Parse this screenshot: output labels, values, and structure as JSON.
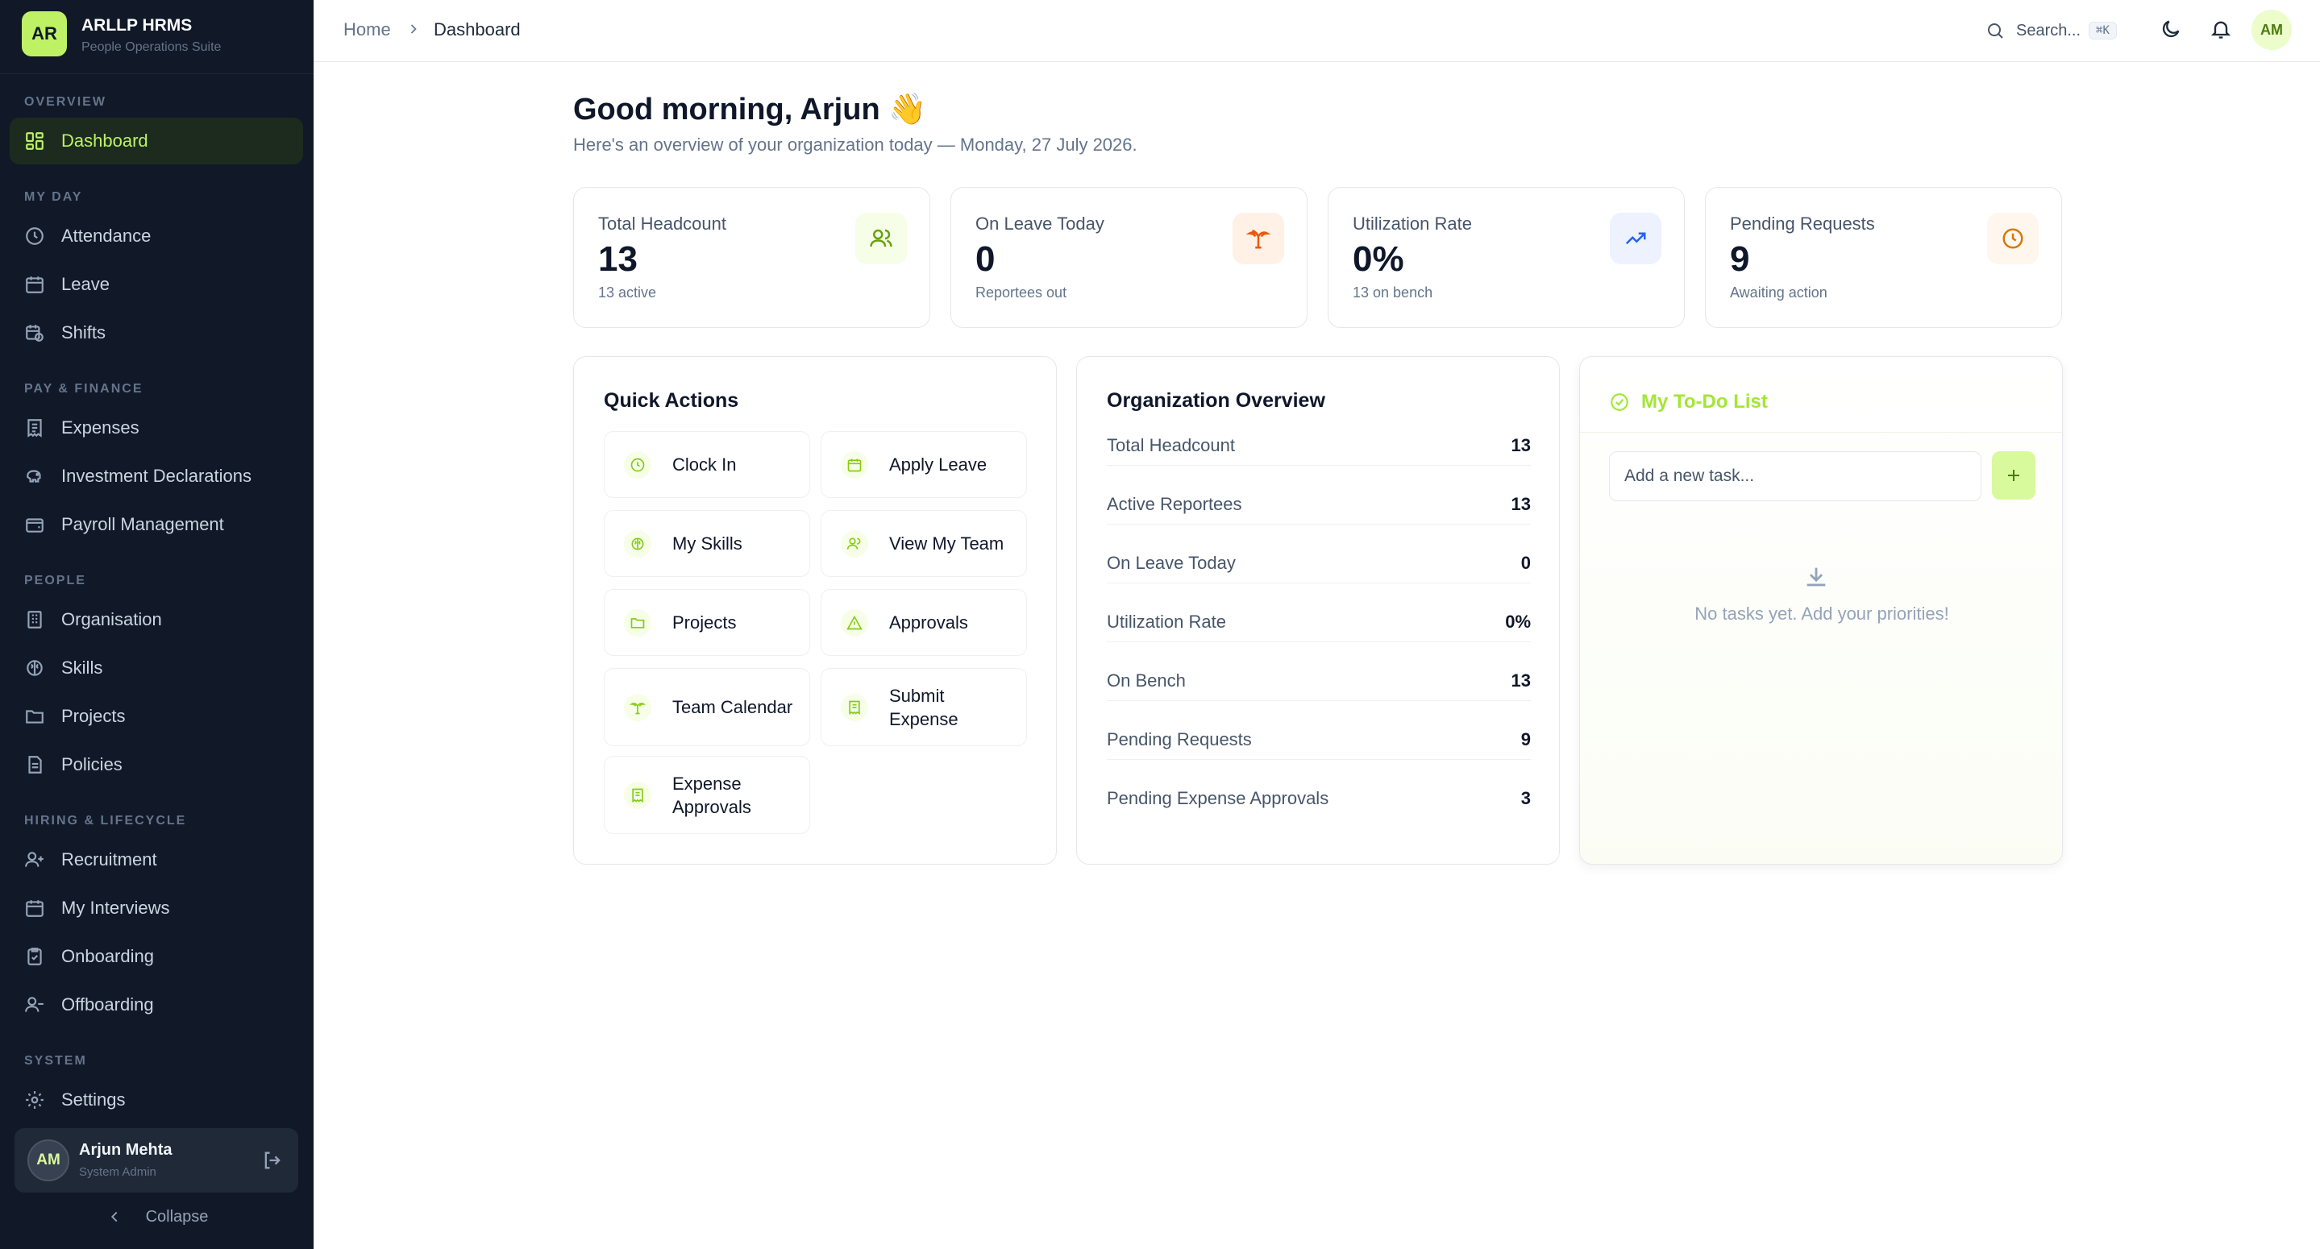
{
  "brand": {
    "initials": "AR",
    "name": "ARLLP HRMS",
    "subtitle": "People Operations Suite"
  },
  "sidebar": {
    "sections": {
      "overview": "OVERVIEW",
      "my_day": "MY DAY",
      "pay": "PAY & FINANCE",
      "people": "PEOPLE",
      "hiring": "HIRING & LIFECYCLE",
      "system": "SYSTEM"
    },
    "items": {
      "dashboard": "Dashboard",
      "attendance": "Attendance",
      "leave": "Leave",
      "shifts": "Shifts",
      "expenses": "Expenses",
      "investment": "Investment Declarations",
      "payroll": "Payroll Management",
      "organisation": "Organisation",
      "skills": "Skills",
      "projects": "Projects",
      "policies": "Policies",
      "recruitment": "Recruitment",
      "interviews": "My Interviews",
      "onboarding": "Onboarding",
      "offboarding": "Offboarding",
      "settings": "Settings"
    },
    "active": "dashboard",
    "user": {
      "initials": "AM",
      "name": "Arjun Mehta",
      "role": "System Admin"
    },
    "collapse_label": "Collapse"
  },
  "topbar": {
    "breadcrumb": [
      "Home",
      "Dashboard"
    ],
    "search_placeholder": "Search...",
    "search_shortcut": "⌘K",
    "avatar_initials": "AM"
  },
  "greeting": {
    "title": "Good morning, Arjun 👋",
    "subtitle": "Here's an overview of your organization today — Monday, 27 July 2026."
  },
  "stats": [
    {
      "label": "Total Headcount",
      "value": "13",
      "note": "13 active",
      "icon": "users-icon",
      "color": "#65a30d",
      "bg": "#f7fee7"
    },
    {
      "label": "On Leave Today",
      "value": "0",
      "note": "Reportees out",
      "icon": "palm-tree-icon",
      "color": "#ea580c",
      "bg": "#fff1e6"
    },
    {
      "label": "Utilization Rate",
      "value": "0%",
      "note": "13 on bench",
      "icon": "trending-up-icon",
      "color": "#2563eb",
      "bg": "#eef2ff"
    },
    {
      "label": "Pending Requests",
      "value": "9",
      "note": "Awaiting action",
      "icon": "clock-icon",
      "color": "#d97706",
      "bg": "#fff7ed"
    }
  ],
  "quick_actions": {
    "title": "Quick Actions",
    "items": [
      {
        "label": "Clock In",
        "icon": "clock-icon"
      },
      {
        "label": "Apply Leave",
        "icon": "calendar-icon"
      },
      {
        "label": "My Skills",
        "icon": "brain-icon"
      },
      {
        "label": "View My Team",
        "icon": "users-icon"
      },
      {
        "label": "Projects",
        "icon": "folder-icon"
      },
      {
        "label": "Approvals",
        "icon": "alert-triangle-icon"
      },
      {
        "label": "Team Calendar",
        "icon": "palm-tree-icon"
      },
      {
        "label": "Submit Expense",
        "icon": "receipt-icon"
      },
      {
        "label": "Expense Approvals",
        "icon": "receipt-icon"
      }
    ]
  },
  "org_overview": {
    "title": "Organization Overview",
    "rows": [
      {
        "label": "Total Headcount",
        "value": "13"
      },
      {
        "label": "Active Reportees",
        "value": "13"
      },
      {
        "label": "On Leave Today",
        "value": "0"
      },
      {
        "label": "Utilization Rate",
        "value": "0%"
      },
      {
        "label": "On Bench",
        "value": "13"
      },
      {
        "label": "Pending Requests",
        "value": "9"
      },
      {
        "label": "Pending Expense Approvals",
        "value": "3"
      }
    ]
  },
  "todo": {
    "title": "My To-Do List",
    "input_placeholder": "Add a new task...",
    "empty_text": "No tasks yet. Add your priorities!"
  },
  "colors": {
    "sidebar_bg": "#111827",
    "accent": "#bef264",
    "accent_text": "#a3e635"
  }
}
